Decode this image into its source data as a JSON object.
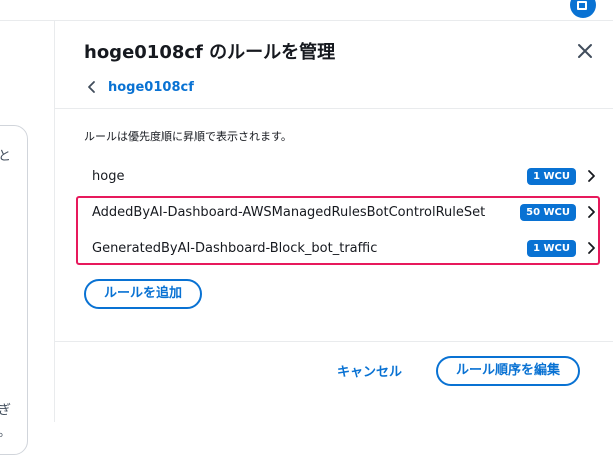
{
  "modal": {
    "title": "hoge0108cf のルールを管理",
    "back_link": "hoge0108cf",
    "description": "ルールは優先度順に昇順で表示されます。",
    "rules": [
      {
        "name": "hoge",
        "wcu": "1 WCU"
      },
      {
        "name": "AddedByAI-Dashboard-AWSManagedRulesBotControlRuleSet",
        "wcu": "50 WCU"
      },
      {
        "name": "GeneratedByAI-Dashboard-Block_bot_traffic",
        "wcu": "1 WCU"
      }
    ],
    "add_rule_label": "ルールを追加",
    "cancel_label": "キャンセル",
    "edit_order_label": "ルール順序を編集"
  },
  "background": {
    "fragments": [
      "と",
      "ぎ",
      "。"
    ]
  },
  "icons": {
    "close": "close-icon",
    "back": "chevron-left-icon",
    "row": "chevron-right-icon",
    "corner": "app-icon"
  },
  "colors": {
    "accent": "#0972d3",
    "highlight": "#e7195c",
    "text": "#16191f",
    "divider": "#e9ebed"
  }
}
